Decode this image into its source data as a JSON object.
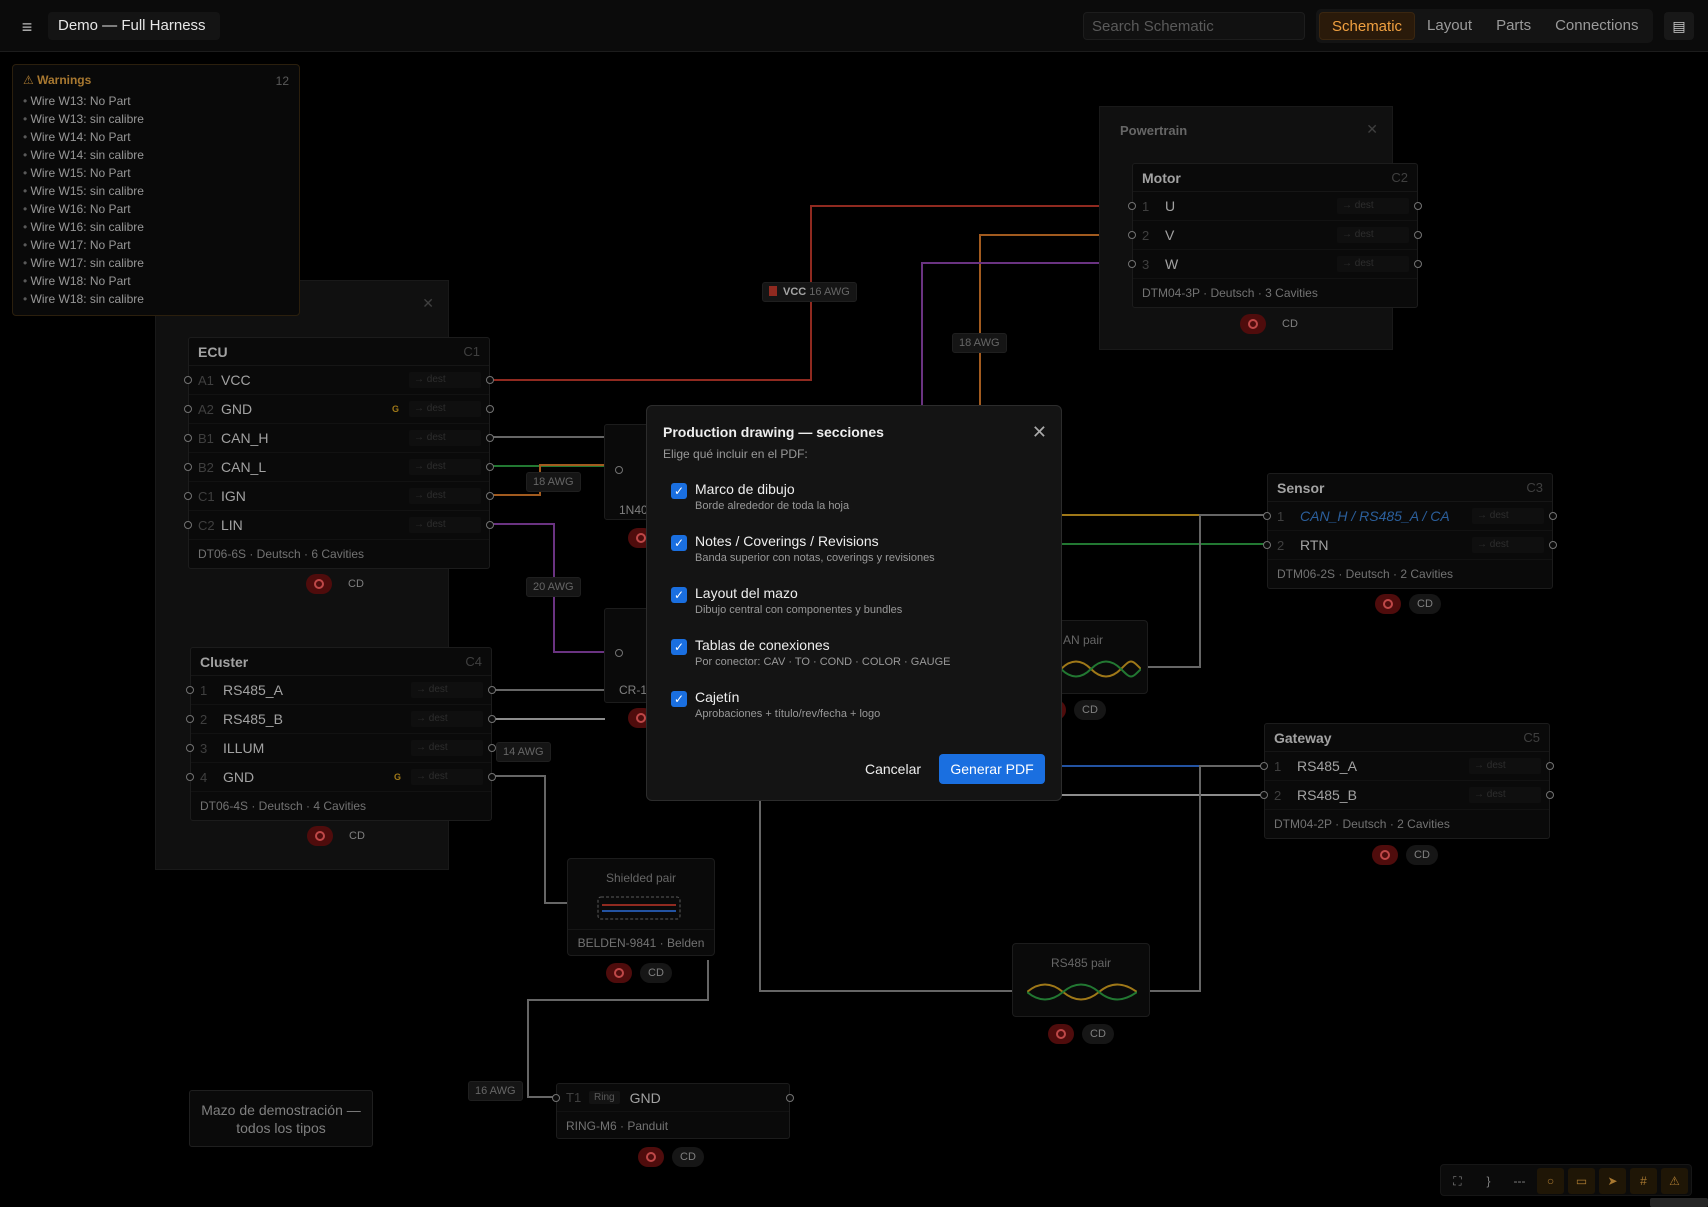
{
  "topbar": {
    "menu_icon": "hamburger-icon",
    "title": "Demo — Full Harness",
    "search_placeholder": "Search Schematic",
    "tabs": [
      "Schematic",
      "Layout",
      "Parts",
      "Connections"
    ],
    "active_tab": "Schematic",
    "panel_icon": "panel-icon"
  },
  "warnings": {
    "title": "⚠ Warnings",
    "count": "12",
    "items": [
      "Wire W13: No Part",
      "Wire W13: sin calibre",
      "Wire W14: No Part",
      "Wire W14: sin calibre",
      "Wire W15: No Part",
      "Wire W15: sin calibre",
      "Wire W16: No Part",
      "Wire W16: sin calibre",
      "Wire W17: No Part",
      "Wire W17: sin calibre",
      "Wire W18: No Part",
      "Wire W18: sin calibre"
    ]
  },
  "groups": {
    "powertrain": "Powertrain",
    "close": "✕"
  },
  "components": {
    "ecu": {
      "name": "ECU",
      "id": "C1",
      "footer": "DT06-6S · Deutsch · 6 Cavities",
      "pins": [
        {
          "no": "A1",
          "name": "VCC",
          "g": "",
          "dest": "→ dest"
        },
        {
          "no": "A2",
          "name": "GND",
          "g": "G",
          "dest": "→ dest"
        },
        {
          "no": "B1",
          "name": "CAN_H",
          "g": "",
          "dest": "→ dest"
        },
        {
          "no": "B2",
          "name": "CAN_L",
          "g": "",
          "dest": "→ dest"
        },
        {
          "no": "C1",
          "name": "IGN",
          "g": "",
          "dest": "→ dest"
        },
        {
          "no": "C2",
          "name": "LIN",
          "g": "",
          "dest": "→ dest"
        }
      ]
    },
    "cluster": {
      "name": "Cluster",
      "id": "C4",
      "footer": "DT06-4S · Deutsch · 4 Cavities",
      "pins": [
        {
          "no": "1",
          "name": "RS485_A",
          "g": "",
          "dest": "→ dest"
        },
        {
          "no": "2",
          "name": "RS485_B",
          "g": "",
          "dest": "→ dest"
        },
        {
          "no": "3",
          "name": "ILLUM",
          "g": "",
          "dest": "→ dest"
        },
        {
          "no": "4",
          "name": "GND",
          "g": "G",
          "dest": "→ dest"
        }
      ]
    },
    "motor": {
      "name": "Motor",
      "id": "C2",
      "footer": "DTM04-3P · Deutsch · 3 Cavities",
      "pins": [
        {
          "no": "1",
          "name": "U",
          "g": "",
          "dest": "→ dest"
        },
        {
          "no": "2",
          "name": "V",
          "g": "",
          "dest": "→ dest"
        },
        {
          "no": "3",
          "name": "W",
          "g": "",
          "dest": "→ dest"
        }
      ]
    },
    "sensor": {
      "name": "Sensor",
      "id": "C3",
      "footer": "DTM06-2S · Deutsch · 2 Cavities",
      "pins": [
        {
          "no": "1",
          "name": "CAN_H / RS485_A / CA",
          "g": "",
          "dest": "→ dest"
        },
        {
          "no": "2",
          "name": "RTN",
          "g": "",
          "dest": "→ dest"
        }
      ]
    },
    "gateway": {
      "name": "Gateway",
      "id": "C5",
      "footer": "DTM04-2P · Deutsch · 2 Cavities",
      "pins": [
        {
          "no": "1",
          "name": "RS485_A",
          "g": "",
          "dest": "→ dest"
        },
        {
          "no": "2",
          "name": "RS485_B",
          "g": "",
          "dest": "→ dest"
        }
      ]
    },
    "ring": {
      "no": "T1",
      "type": "Ring",
      "name": "GND",
      "footer": "RING-M6 · Panduit"
    }
  },
  "partial_labels": {
    "diode": "1N40",
    "relay": "CR-1",
    "canpair": "AN pair"
  },
  "cables": {
    "shielded": {
      "title": "Shielded pair",
      "footer": "BELDEN-9841 · Belden"
    },
    "rs485": {
      "title": "RS485 pair"
    }
  },
  "wire_labels": {
    "vcc": "VCC",
    "vcc_awg": "16 AWG",
    "w1": "18 AWG",
    "w2": "18 AWG",
    "w3": "20 AWG",
    "w4": "14 AWG",
    "w5": "16 AWG"
  },
  "badge_cd": "CD",
  "note": "Mazo de demostración — todos los tipos",
  "dialog": {
    "title": "Production drawing — secciones",
    "subtitle": "Elige qué incluir en el PDF:",
    "options": [
      {
        "label": "Marco de dibujo",
        "desc": "Borde alrededor de toda la hoja",
        "checked": true
      },
      {
        "label": "Notes / Coverings / Revisions",
        "desc": "Banda superior con notas, coverings y revisiones",
        "checked": true
      },
      {
        "label": "Layout del mazo",
        "desc": "Dibujo central con componentes y bundles",
        "checked": true
      },
      {
        "label": "Tablas de conexiones",
        "desc": "Por conector: CAV · TO · COND · COLOR · GAUGE",
        "checked": true
      },
      {
        "label": "Cajetín",
        "desc": "Aprobaciones + título/rev/fecha + logo",
        "checked": true
      }
    ],
    "cancel": "Cancelar",
    "confirm": "Generar PDF"
  },
  "toolbar": {
    "tools": [
      "⛶",
      "}",
      "---",
      "○",
      "▭",
      "➤",
      "#",
      "⚠"
    ],
    "active": [
      "○",
      "▭",
      "➤",
      "#",
      "⚠"
    ]
  },
  "colors": {
    "accent": "#f0a040",
    "primary": "#1a6fe0",
    "wire_red": "#c0392b",
    "wire_orange": "#d97a2a",
    "wire_green": "#2ea043",
    "wire_purple": "#8e44ad",
    "wire_blue": "#2f6fd8"
  }
}
